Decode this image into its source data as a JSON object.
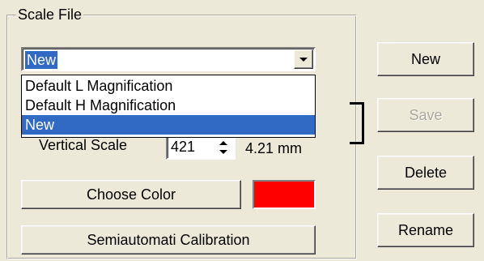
{
  "group": {
    "title": "Scale File"
  },
  "combo": {
    "selected": "New",
    "options": [
      "Default L Magnification",
      "Default H Magnification",
      "New"
    ]
  },
  "vertical_scale": {
    "label": "Vertical Scale",
    "value": "421",
    "converted": "4.21 mm"
  },
  "buttons": {
    "choose_color": "Choose Color",
    "semiauto": "Semiautomati Calibration",
    "new": "New",
    "save": "Save",
    "delete": "Delete",
    "rename": "Rename"
  },
  "colors": {
    "selected_color": "#ff0000",
    "highlight": "#316ac5"
  }
}
